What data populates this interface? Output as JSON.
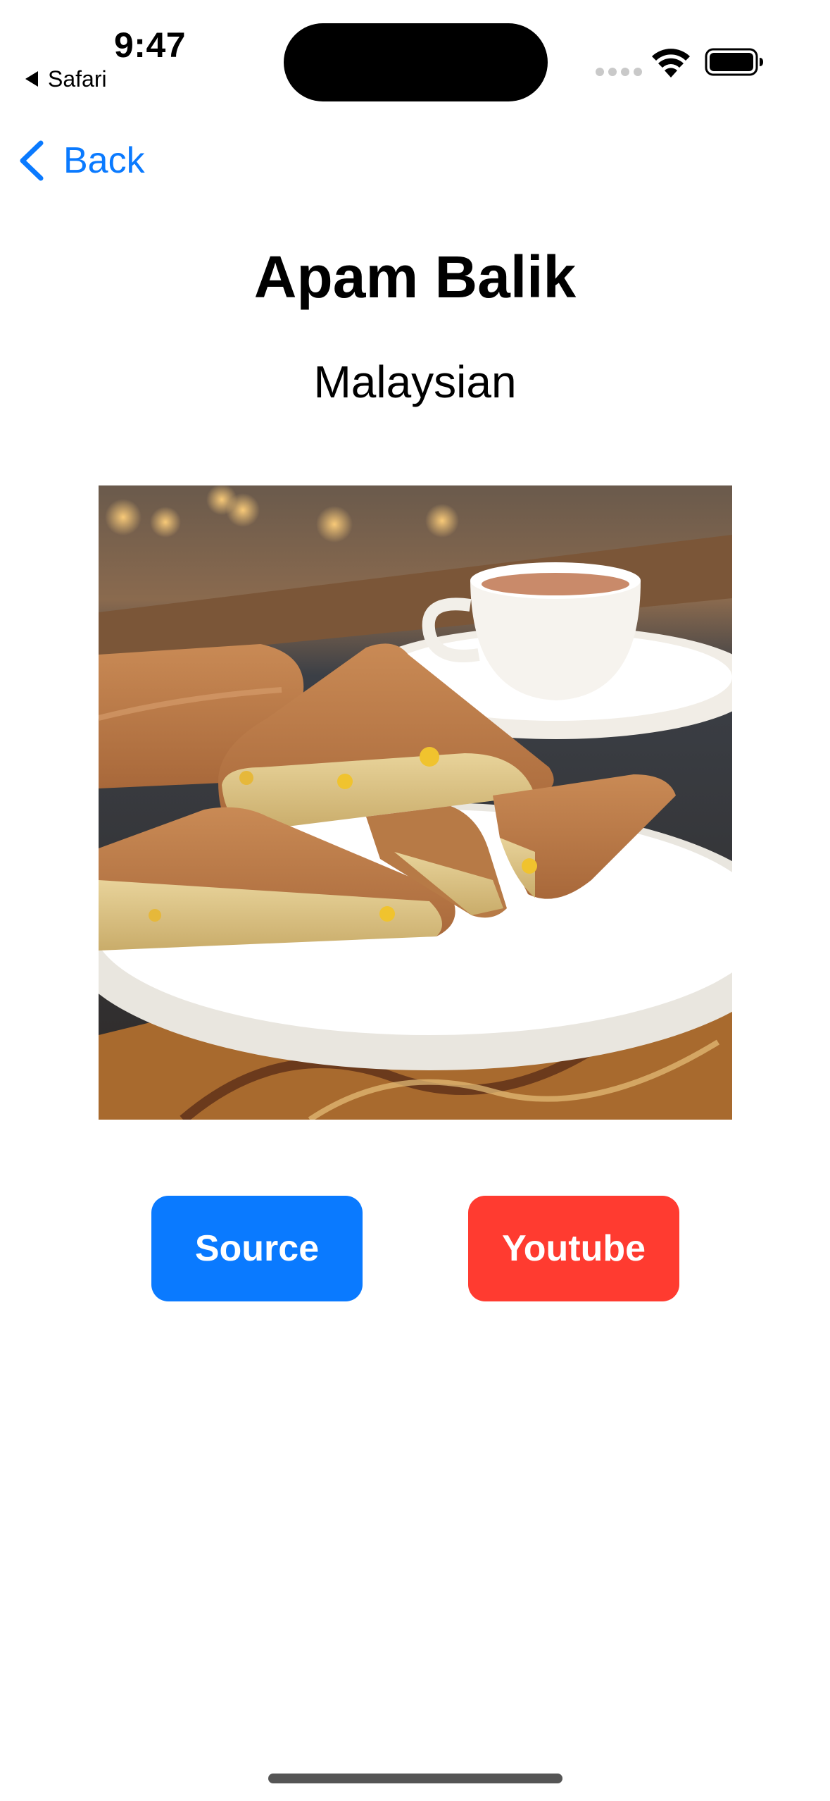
{
  "status_bar": {
    "time": "9:47",
    "back_app": "Safari"
  },
  "nav": {
    "back_label": "Back"
  },
  "recipe": {
    "title": "Apam Balik",
    "cuisine": "Malaysian",
    "image_icon": "food-photo"
  },
  "buttons": {
    "source_label": "Source",
    "youtube_label": "Youtube"
  },
  "colors": {
    "accent": "#0A7AFF",
    "youtube": "#FF3B30",
    "background": "#FFFFFF"
  }
}
